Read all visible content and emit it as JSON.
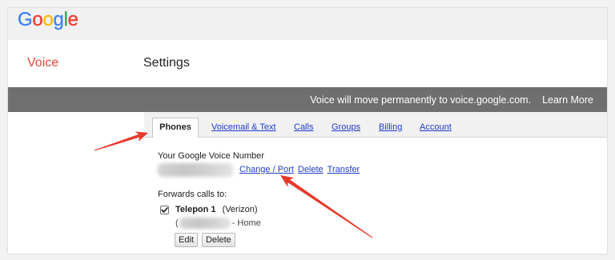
{
  "logo": {
    "letters": [
      "G",
      "o",
      "o",
      "g",
      "l",
      "e"
    ],
    "colors": [
      "#4285F4",
      "#EA4335",
      "#FBBC05",
      "#4285F4",
      "#34A853",
      "#EA4335"
    ]
  },
  "header": {
    "product": "Voice",
    "page_title": "Settings"
  },
  "banner": {
    "message": "Voice will move permanently to voice.google.com.",
    "link": "Learn More"
  },
  "tabs": [
    {
      "label": "Phones",
      "selected": true
    },
    {
      "label": "Voicemail & Text",
      "selected": false
    },
    {
      "label": "Calls",
      "selected": false
    },
    {
      "label": "Groups",
      "selected": false
    },
    {
      "label": "Billing",
      "selected": false
    },
    {
      "label": "Account",
      "selected": false
    }
  ],
  "phones": {
    "number_heading": "Your Google Voice Number",
    "number_actions": [
      "Change / Port",
      "Delete",
      "Transfer"
    ],
    "forwards_heading": "Forwards calls to:",
    "forwarding": [
      {
        "checked": true,
        "name": "Telepon 1",
        "carrier": "(Verizon)",
        "number_prefix": "(",
        "number_suffix": "- Home",
        "buttons": [
          "Edit",
          "Delete"
        ]
      }
    ]
  },
  "colors": {
    "brand_red": "#dd4b39",
    "link": "#1f3bcc",
    "banner": "#6f6f6f",
    "annotation": "#e8392c"
  }
}
